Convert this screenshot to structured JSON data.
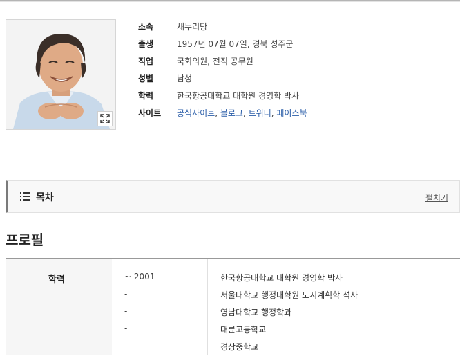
{
  "profile_card": {
    "photo_alt": "",
    "fields": [
      {
        "label": "소속",
        "value": "새누리당"
      },
      {
        "label": "출생",
        "value": "1957년 07월 07일, 경북 성주군"
      },
      {
        "label": "직업",
        "value": "국회의원, 전직 공무원"
      },
      {
        "label": "성별",
        "value": "남성"
      },
      {
        "label": "학력",
        "value": "한국항공대학교 대학원 경영학 박사"
      }
    ],
    "site": {
      "label": "사이트",
      "links": [
        "공식사이트",
        "블로그",
        "트위터",
        "페이스북"
      ]
    }
  },
  "toc": {
    "title": "목차",
    "toggle": "펼치기"
  },
  "section": {
    "title": "프로필"
  },
  "education": {
    "header": "학력",
    "rows": [
      {
        "date": "~ 2001",
        "school": "한국항공대학교 대학원 경영학 박사"
      },
      {
        "date": "-",
        "school": "서울대학교 행정대학원 도시계획학 석사"
      },
      {
        "date": "-",
        "school": "영남대학교 행정학과"
      },
      {
        "date": "-",
        "school": "대륜고등학교"
      },
      {
        "date": "-",
        "school": "경상중학교"
      }
    ]
  },
  "colors": {
    "link": "#2a5da8",
    "accent_bar": "#7a7a7a"
  }
}
